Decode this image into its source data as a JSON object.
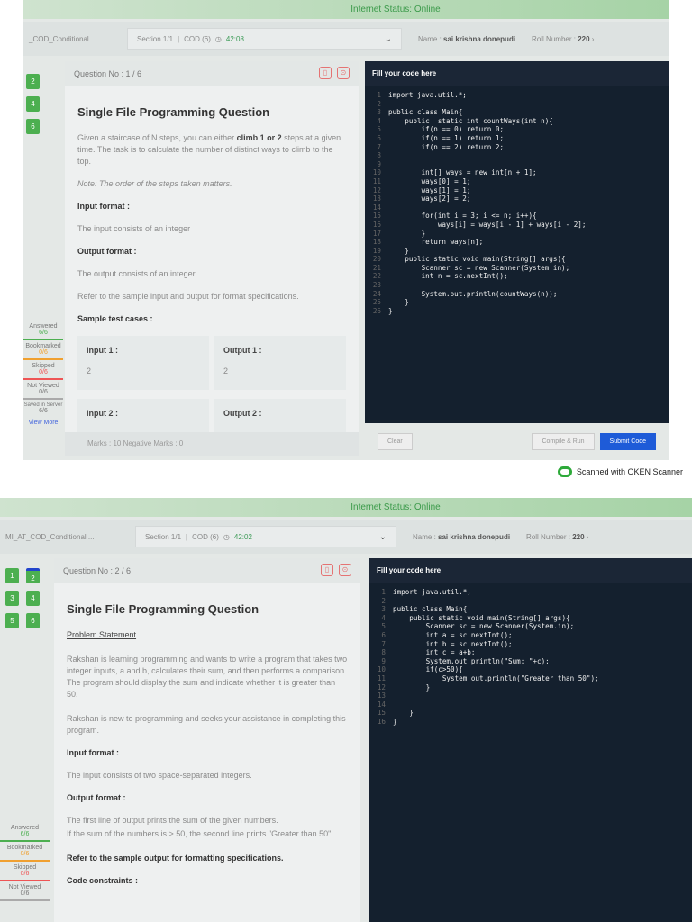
{
  "screens": [
    {
      "internet_status": "Internet Status: Online",
      "breadcrumb": "_COD_Conditional ...",
      "section": "Section 1/1",
      "section_sub": "COD (6)",
      "timer": "42:08",
      "name_label": "Name :",
      "name": "sai krishna donepudi",
      "roll_label": "Roll Number :",
      "roll": "220",
      "question_numbers": [
        "2",
        "4",
        "6"
      ],
      "legend": [
        {
          "label": "Answered",
          "value": "6/6"
        },
        {
          "label": "Bookmarked",
          "value": "0/6"
        },
        {
          "label": "Skipped",
          "value": "0/6"
        },
        {
          "label": "Not Viewed",
          "value": "0/6"
        },
        {
          "label": "Saved in Server",
          "value": "6/6"
        }
      ],
      "view_more": "View More",
      "question_no": "Question No : 1 / 6",
      "question_type": "Single File Programming Question",
      "statement_pre": "Given a staircase of N steps, you can either ",
      "statement_bold": "climb 1 or 2",
      "statement_post": " steps at a given time. The task is to calculate the number of distinct ways to climb to the top.",
      "note": "Note: The order of the steps taken matters.",
      "input_format_label": "Input format :",
      "input_format": "The input consists of an integer",
      "output_format_label": "Output format :",
      "output_format": "The output consists of an integer",
      "refer": "Refer to the sample input and output for format specifications.",
      "sample_label": "Sample test cases :",
      "tests": [
        {
          "in_label": "Input 1 :",
          "in": "2",
          "out_label": "Output 1 :",
          "out": "2"
        },
        {
          "in_label": "Input 2 :",
          "in": "",
          "out_label": "Output 2 :",
          "out": ""
        }
      ],
      "marks": "Marks : 10    Negative Marks : 0",
      "code_title": "Fill your code here",
      "code": [
        "import java.util.*;",
        "",
        "public class Main{",
        "    public  static int countWays(int n){",
        "        if(n == 0) return 0;",
        "        if(n == 1) return 1;",
        "        if(n == 2) return 2;",
        "",
        "",
        "        int[] ways = new int[n + 1];",
        "        ways[0] = 1;",
        "        ways[1] = 1;",
        "        ways[2] = 2;",
        "",
        "        for(int i = 3; i <= n; i++){",
        "            ways[i] = ways[i - 1] + ways[i - 2];",
        "        }",
        "        return ways[n];",
        "    }",
        "    public static void main(String[] args){",
        "        Scanner sc = new Scanner(System.in);",
        "        int n = sc.nextInt();",
        "",
        "        System.out.println(countWays(n));",
        "    }",
        "}"
      ],
      "clear": "Clear",
      "compile": "Compile & Run",
      "submit": "Submit Code"
    },
    {
      "internet_status": "Internet Status: Online",
      "breadcrumb": "MI_AT_COD_Conditional ...",
      "section": "Section 1/1",
      "section_sub": "COD (6)",
      "timer": "42:02",
      "name_label": "Name :",
      "name": "sai krishna donepudi",
      "roll_label": "Roll Number :",
      "roll": "220",
      "question_numbers": [
        "1",
        "2",
        "3",
        "4",
        "5",
        "6"
      ],
      "legend": [
        {
          "label": "Answered",
          "value": "6/6"
        },
        {
          "label": "Bookmarked",
          "value": "0/6"
        },
        {
          "label": "Skipped",
          "value": "0/6"
        },
        {
          "label": "Not Viewed",
          "value": "0/6"
        }
      ],
      "question_no": "Question No : 2 / 6",
      "question_type": "Single File Programming Question",
      "problem_label": "Problem Statement",
      "statement": "Rakshan is learning programming and wants to write a program that takes two integer inputs, a and b, calculates their sum, and then performs a comparison. The program should display the sum and indicate whether it is greater than 50.",
      "statement2": "Rakshan is new to programming and seeks your assistance in completing this program.",
      "input_format_label": "Input format :",
      "input_format": "The input consists of two space-separated integers.",
      "output_format_label": "Output format :",
      "output_format_1": "The first line of output prints the sum of the given numbers.",
      "output_format_2": "If the sum of the numbers is > 50, the second line prints \"Greater than 50\".",
      "refer": "Refer to the sample output for formatting specifications.",
      "constraints_label": "Code constraints :",
      "code_title": "Fill your code here",
      "code": [
        "import java.util.*;",
        "",
        "public class Main{",
        "    public static void main(String[] args){",
        "        Scanner sc = new Scanner(System.in);",
        "        int a = sc.nextInt();",
        "        int b = sc.nextInt();",
        "        int c = a+b;",
        "        System.out.println(\"Sum: \"+c);",
        "        if(c>50){",
        "            System.out.println(\"Greater than 50\");",
        "        }",
        "",
        "",
        "    }",
        "}"
      ]
    }
  ],
  "scanner_caption": "Scanned with OKEN Scanner"
}
